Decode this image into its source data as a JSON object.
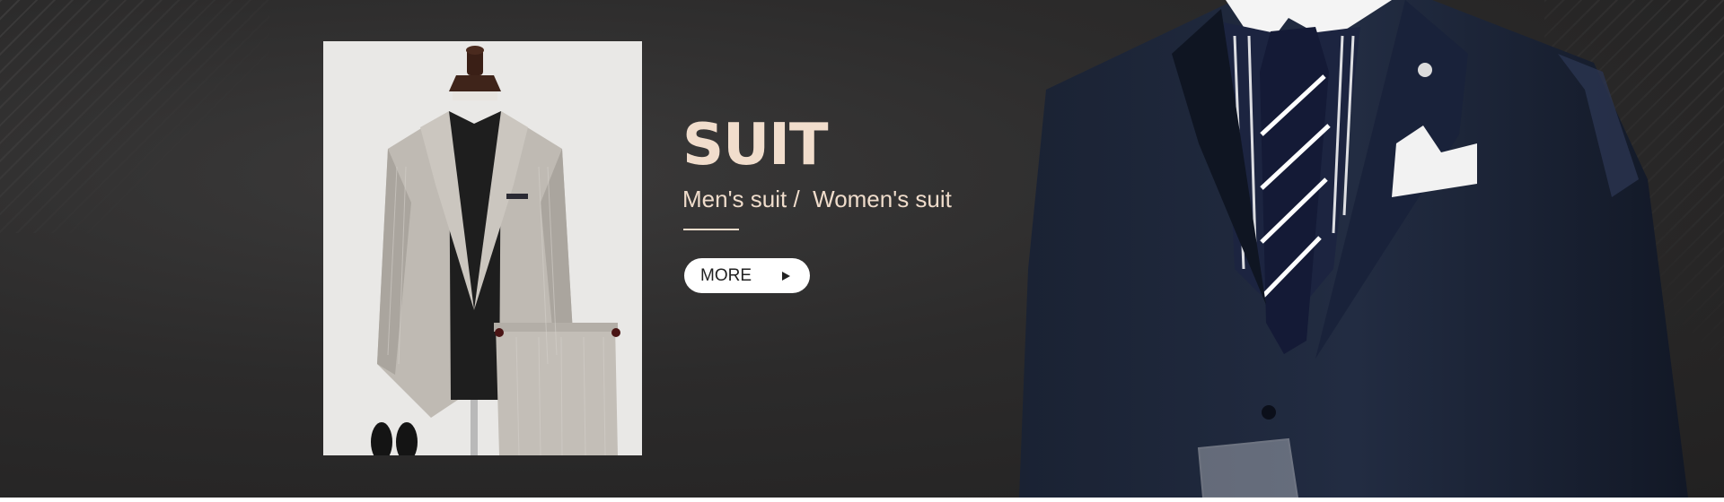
{
  "banner": {
    "title": "SUIT",
    "subtitle": "Men's suit /  Women's suit",
    "more_button": {
      "label": "MORE",
      "icon": "play-icon"
    }
  },
  "colors": {
    "background": "#2b2a2a",
    "accent_text": "#f1ddcc",
    "button_bg": "#ffffff",
    "product_bg": "#e9e8e6",
    "model_suit": "#1b2438"
  },
  "images": {
    "product": "grey-pinstripe-suit-on-mannequin",
    "model": "man-in-navy-suit-striped-tie"
  }
}
